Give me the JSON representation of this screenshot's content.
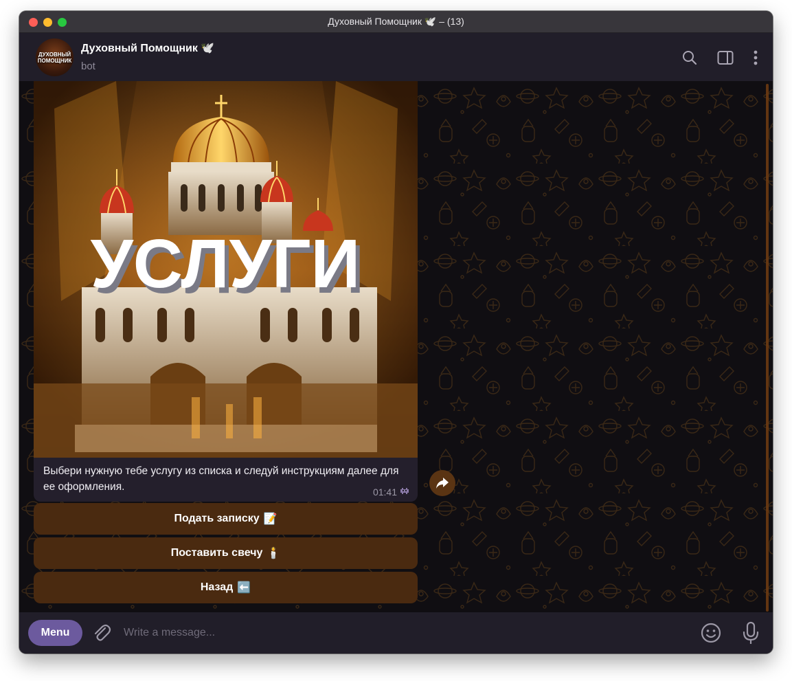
{
  "window": {
    "title": "Духовный Помощник 🕊️ – (13)"
  },
  "header": {
    "avatar_text": "ДУХОВНЫЙ ПОМОЩНИК",
    "bot_name": "Духовный Помощник 🕊️",
    "status": "bot",
    "icons": [
      "search-icon",
      "sidebar-toggle-icon",
      "more-vertical-icon"
    ]
  },
  "message": {
    "image_title": "УСЛУГИ",
    "text": "Выбери нужную тебе услугу из списка и следуй инструкциям далее для ее оформления.",
    "time": "01:41",
    "time_icon": "alien-monster-icon"
  },
  "keyboard": {
    "buttons": [
      {
        "label": "Подать записку",
        "emoji": "📝"
      },
      {
        "label": "Поставить свечу",
        "emoji": "🕯️"
      },
      {
        "label": "Назад",
        "emoji": "⬅️"
      }
    ]
  },
  "composer": {
    "menu_label": "Menu",
    "placeholder": "Write a message..."
  },
  "colors": {
    "accent": "#6c5a9e",
    "keyboard_button": "#4a2a10",
    "bubble": "#241f2c",
    "header": "#211e29"
  }
}
